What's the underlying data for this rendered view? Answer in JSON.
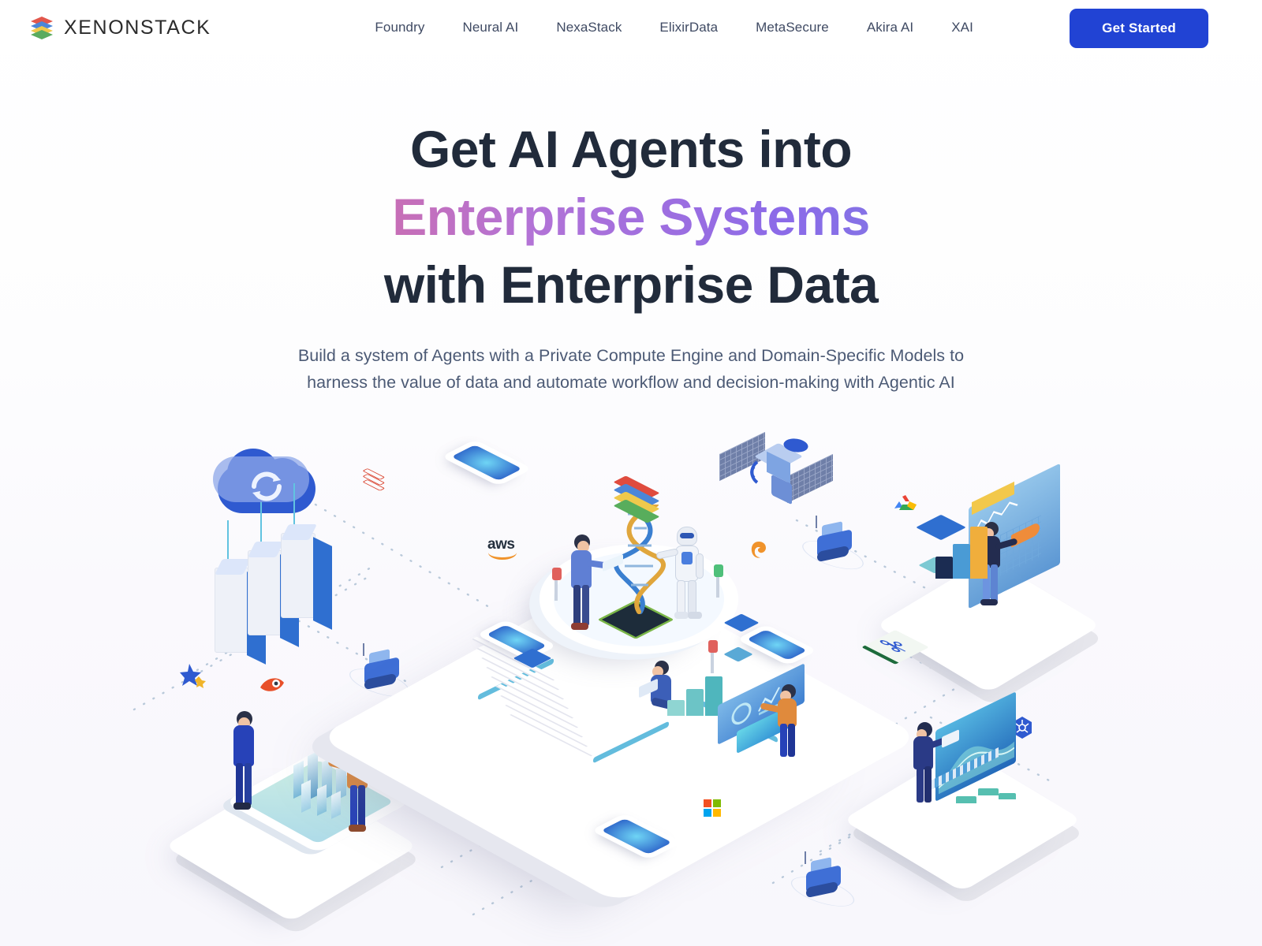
{
  "brand": {
    "name": "XENONSTACK",
    "logo_icon": "stacked-layers-icon",
    "logo_colors": [
      "#e2574c",
      "#4b86d8",
      "#efc94c",
      "#5aab5e"
    ]
  },
  "nav": {
    "items": [
      {
        "label": "Foundry"
      },
      {
        "label": "Neural AI"
      },
      {
        "label": "NexaStack"
      },
      {
        "label": "ElixirData"
      },
      {
        "label": "MetaSecure"
      },
      {
        "label": "Akira AI"
      },
      {
        "label": "XAI"
      }
    ]
  },
  "cta": {
    "label": "Get Started",
    "bg_color": "#2143d4",
    "text_color": "#ffffff"
  },
  "hero": {
    "line1": "Get AI Agents into",
    "line2": "Enterprise Systems",
    "line3": "with Enterprise Data",
    "gradient_start": "#f2706e",
    "gradient_mid": "#9b6fe0",
    "gradient_end": "#8a9be0",
    "heading_color": "#212b3b",
    "subtitle_line1": "Build a system of Agents with a Private Compute Engine and Domain-Specific Models to",
    "subtitle_line2": "harness the value of data and automate workflow and decision-making with Agentic AI",
    "subtitle_color": "#4c5a75"
  },
  "illustration": {
    "alt": "Isometric enterprise AI platform illustration",
    "elements": [
      {
        "name": "cloud-sync-icon",
        "label": ""
      },
      {
        "name": "server-racks",
        "label": ""
      },
      {
        "name": "redis-layers-icon",
        "label": ""
      },
      {
        "name": "rover-robot-left",
        "label": ""
      },
      {
        "name": "star-icon",
        "label": ""
      },
      {
        "name": "comet-icon",
        "label": ""
      },
      {
        "name": "digital-twin-city-platform",
        "label": ""
      },
      {
        "name": "aws-logo",
        "label": "aws"
      },
      {
        "name": "xenonstack-layers-icon",
        "label": ""
      },
      {
        "name": "satellite-icon",
        "label": ""
      },
      {
        "name": "grafana-icon",
        "label": ""
      },
      {
        "name": "central-platform",
        "label": ""
      },
      {
        "name": "dna-helix",
        "label": ""
      },
      {
        "name": "humanoid-robot",
        "label": ""
      },
      {
        "name": "scientist-person",
        "label": ""
      },
      {
        "name": "analyst-person",
        "label": ""
      },
      {
        "name": "control-room-person",
        "label": ""
      },
      {
        "name": "google-cloud-logo",
        "label": ""
      },
      {
        "name": "analytics-dashboard-platform",
        "label": ""
      },
      {
        "name": "airflow-icon",
        "label": ""
      },
      {
        "name": "kubernetes-icon",
        "label": ""
      },
      {
        "name": "data-visualization-platform",
        "label": ""
      },
      {
        "name": "microsoft-logo",
        "label": ""
      },
      {
        "name": "rover-robot-bottom",
        "label": ""
      },
      {
        "name": "edge-device-pod",
        "label": ""
      }
    ]
  }
}
